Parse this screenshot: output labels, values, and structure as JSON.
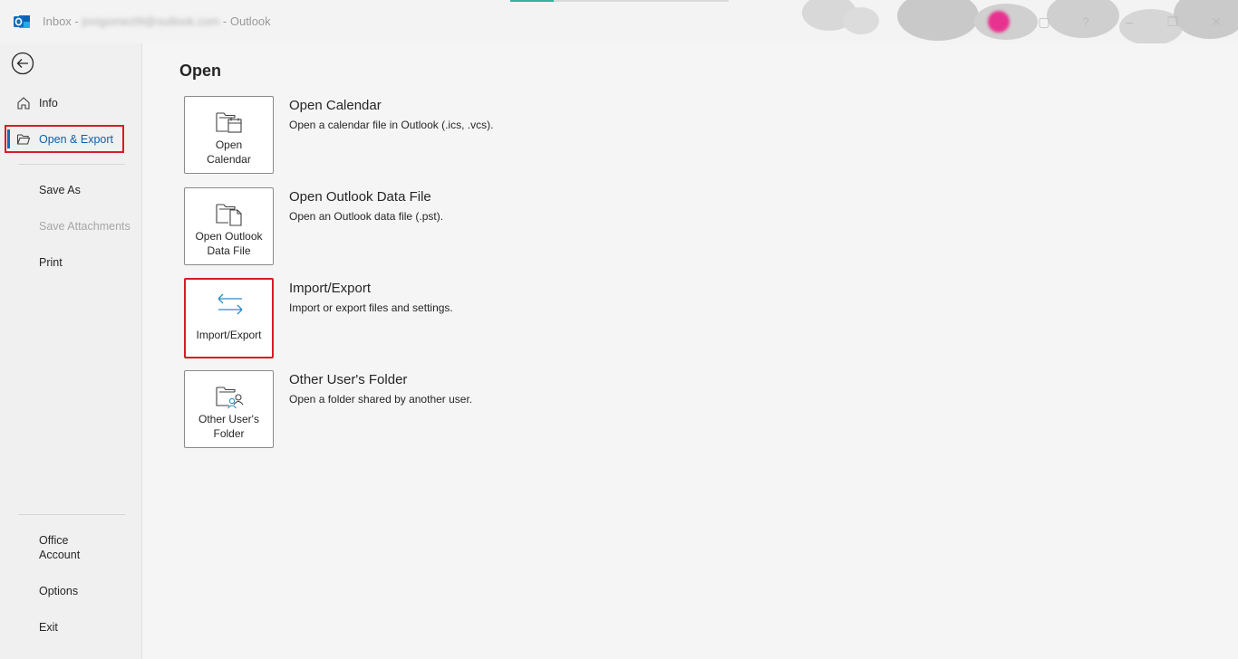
{
  "titlebar": {
    "title_prefix": "Inbox - ",
    "email_blurred": "jovigomezl9@outlook.com",
    "title_suffix": "  -  Outlook"
  },
  "sidebar": {
    "items": [
      {
        "label": "Info",
        "icon": "home-icon"
      },
      {
        "label": "Open & Export",
        "icon": "folder-open-icon"
      },
      {
        "label": "Save As"
      },
      {
        "label": "Save Attachments"
      },
      {
        "label": "Print"
      },
      {
        "label": "Office\nAccount"
      },
      {
        "label": "Options"
      },
      {
        "label": "Exit"
      }
    ]
  },
  "main": {
    "title": "Open",
    "options": [
      {
        "tile_line1": "Open",
        "tile_line2": "Calendar",
        "title": "Open Calendar",
        "desc": "Open a calendar file in Outlook (.ics, .vcs).",
        "icon": "folder-calendar-icon"
      },
      {
        "tile_line1": "Open Outlook",
        "tile_line2": "Data File",
        "title": "Open Outlook Data File",
        "desc": "Open an Outlook data file (.pst).",
        "icon": "folder-file-icon"
      },
      {
        "tile_line1": "Import/Export",
        "title": "Import/Export",
        "desc": "Import or export files and settings.",
        "icon": "import-export-arrows-icon"
      },
      {
        "tile_line1": "Other User's",
        "tile_line2": "Folder",
        "title": "Other User's Folder",
        "desc": "Open a folder shared by another user.",
        "icon": "folder-user-icon"
      }
    ]
  },
  "colors": {
    "accent": "#0f6cbd",
    "highlight": "#d71c28",
    "avatar": "#e8328f"
  }
}
